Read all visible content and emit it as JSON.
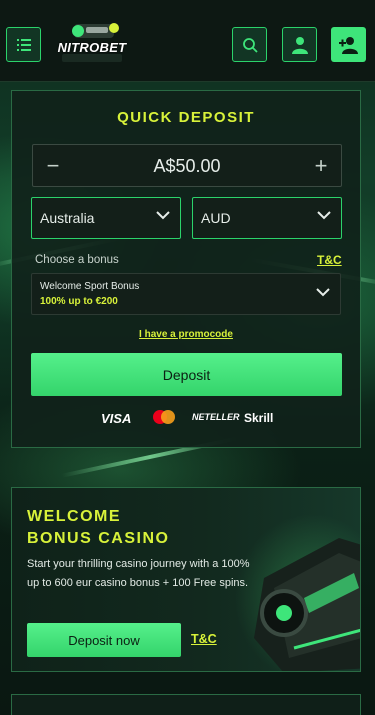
{
  "brand": {
    "logo_text": "NITROBET",
    "accent_color": "#3ee57a",
    "highlight_color": "#d8f23a"
  },
  "header": {
    "menu_icon": "menu-icon",
    "search_icon": "search-icon",
    "login_icon": "user-icon",
    "register_icon": "user-plus-icon"
  },
  "quick_deposit": {
    "title": "QUICK DEPOSIT",
    "amount": "A$50.00",
    "decrease_symbol": "−",
    "increase_symbol": "+",
    "country": "Australia",
    "currency": "AUD",
    "bonus_label": "Choose a bonus",
    "tc_label": "T&C",
    "bonus_name": "Welcome Sport Bonus",
    "bonus_amount": "100% up to €200",
    "promo_link": "I have a promocode",
    "deposit_button": "Deposit",
    "payments": {
      "visa": "VISA",
      "mastercard": "mastercard",
      "neteller": "NETELLER",
      "skrill": "Skrill"
    }
  },
  "welcome_card": {
    "title_line1": "WELCOME",
    "title_line2": "BONUS CASINO",
    "description": "Start your thrilling casino journey with a 100% up to 600 eur casino bonus + 100 Free spins.",
    "cta_button": "Deposit now",
    "tc_label": "T&C"
  }
}
